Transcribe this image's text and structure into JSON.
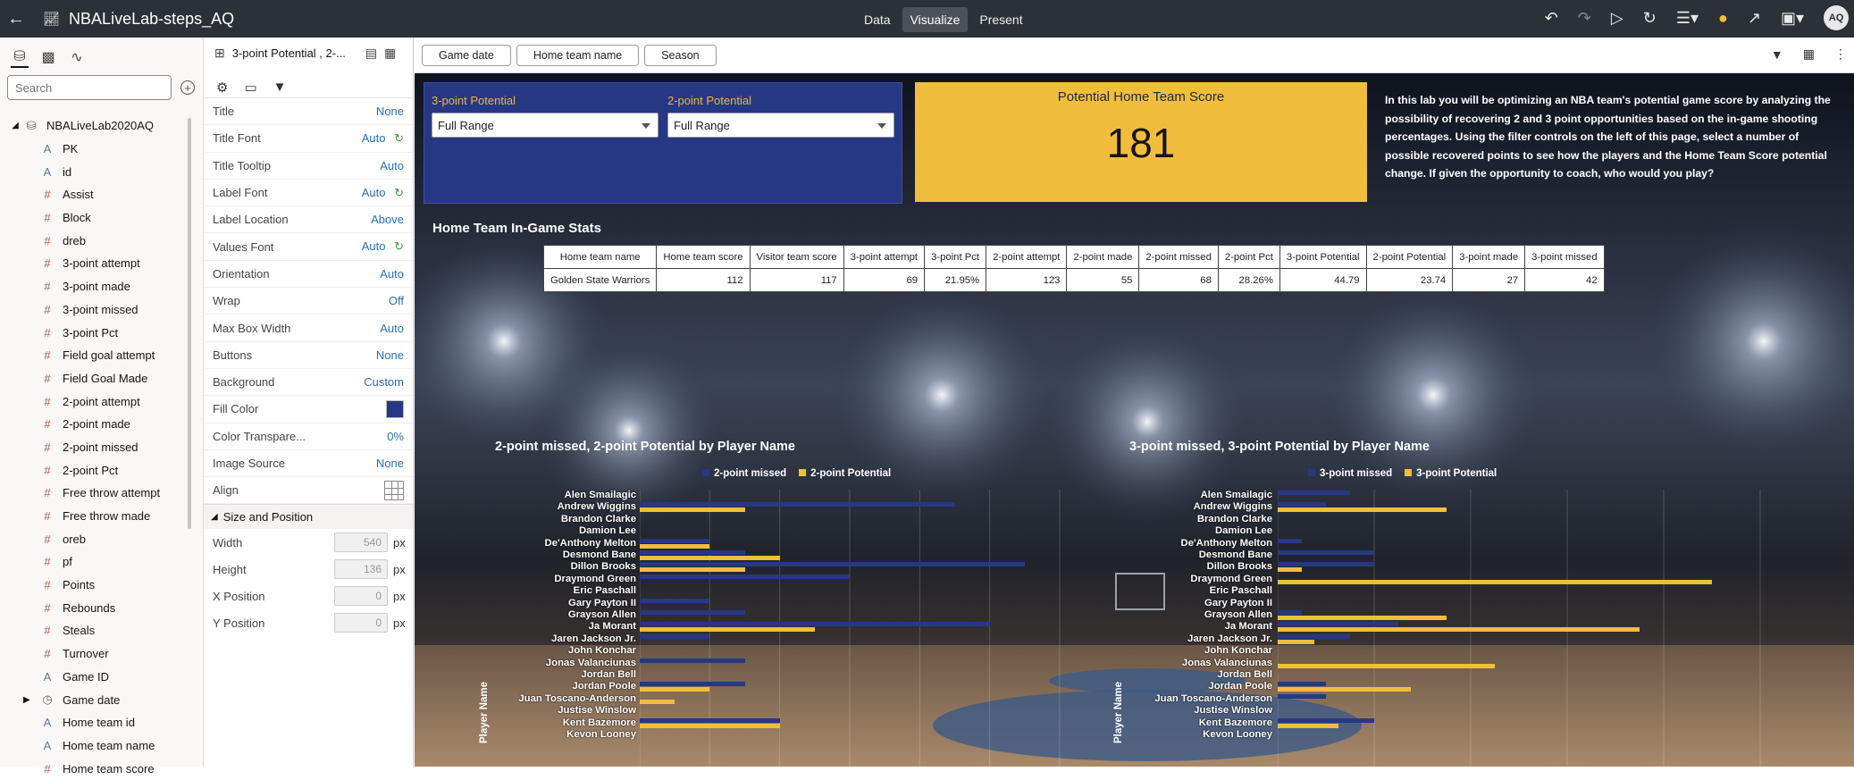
{
  "app": {
    "title": "NBALiveLab-steps_AQ",
    "modes": [
      "Data",
      "Visualize",
      "Present"
    ],
    "active_mode": "Visualize",
    "avatar": "AQ"
  },
  "left_panel": {
    "search_placeholder": "Search",
    "dataset": "NBALiveLab2020AQ",
    "items": [
      {
        "label": "PK",
        "kind": "text"
      },
      {
        "label": "id",
        "kind": "text"
      },
      {
        "label": "Assist",
        "kind": "number"
      },
      {
        "label": "Block",
        "kind": "number"
      },
      {
        "label": "dreb",
        "kind": "number"
      },
      {
        "label": "3-point attempt",
        "kind": "number"
      },
      {
        "label": "3-point made",
        "kind": "number"
      },
      {
        "label": "3-point missed",
        "kind": "number"
      },
      {
        "label": "3-point Pct",
        "kind": "number"
      },
      {
        "label": "Field goal attempt",
        "kind": "number"
      },
      {
        "label": "Field Goal Made",
        "kind": "number"
      },
      {
        "label": "2-point attempt",
        "kind": "number"
      },
      {
        "label": "2-point made",
        "kind": "number"
      },
      {
        "label": "2-point missed",
        "kind": "number"
      },
      {
        "label": "2-point Pct",
        "kind": "number"
      },
      {
        "label": "Free throw attempt",
        "kind": "number"
      },
      {
        "label": "Free throw made",
        "kind": "number"
      },
      {
        "label": "oreb",
        "kind": "number"
      },
      {
        "label": "pf",
        "kind": "number"
      },
      {
        "label": "Points",
        "kind": "number"
      },
      {
        "label": "Rebounds",
        "kind": "number"
      },
      {
        "label": "Steals",
        "kind": "number"
      },
      {
        "label": "Turnover",
        "kind": "number"
      },
      {
        "label": "Game ID",
        "kind": "text"
      },
      {
        "label": "Game date",
        "kind": "clock"
      },
      {
        "label": "Home team id",
        "kind": "text"
      },
      {
        "label": "Home team name",
        "kind": "text"
      },
      {
        "label": "Home team score",
        "kind": "number"
      }
    ]
  },
  "props": {
    "header": "3-point Potential , 2-...",
    "rows": [
      {
        "label": "Title",
        "value": "None"
      },
      {
        "label": "Title Font",
        "value": "Auto"
      },
      {
        "label": "Title Tooltip",
        "value": "Auto"
      },
      {
        "label": "Label Font",
        "value": "Auto"
      },
      {
        "label": "Label Location",
        "value": "Above"
      },
      {
        "label": "Values Font",
        "value": "Auto"
      },
      {
        "label": "Orientation",
        "value": "Auto"
      },
      {
        "label": "Wrap",
        "value": "Off"
      },
      {
        "label": "Max Box Width",
        "value": "Auto"
      },
      {
        "label": "Buttons",
        "value": "None"
      },
      {
        "label": "Background",
        "value": "Custom"
      },
      {
        "label": "Fill Color",
        "value": ""
      },
      {
        "label": "Color Transpare...",
        "value": "0%"
      },
      {
        "label": "Image Source",
        "value": "None"
      },
      {
        "label": "Align",
        "value": ""
      }
    ],
    "fill_color": "#263884",
    "size_header": "Size and Position",
    "size": [
      {
        "label": "Width",
        "value": "540",
        "unit": "px"
      },
      {
        "label": "Height",
        "value": "136",
        "unit": "px"
      },
      {
        "label": "X Position",
        "value": "0",
        "unit": "px"
      },
      {
        "label": "Y Position",
        "value": "0",
        "unit": "px"
      }
    ]
  },
  "filters": [
    "Game date",
    "Home team name",
    "Season"
  ],
  "canvas": {
    "controls": [
      {
        "label": "3-point Potential",
        "value": "Full Range"
      },
      {
        "label": "2-point Potential",
        "value": "Full Range"
      }
    ],
    "score": {
      "title": "Potential Home Team Score",
      "value": "181"
    },
    "intro": "In this lab you will be optimizing an NBA team's potential game score by analyzing the possibility of recovering 2 and 3 point opportunities based on the in-game shooting percentages. Using the filter controls on the left of this page, select a number of possible recovered points to see how the players and the Home Team Score potential change. If given the opportunity to coach, who would you play?",
    "table_title": "Home Team In-Game Stats",
    "table": {
      "headers": [
        "Home team name",
        "Home team score",
        "Visitor team score",
        "3-point attempt",
        "3-point Pct",
        "2-point attempt",
        "2-point made",
        "2-point missed",
        "2-point Pct",
        "3-point Potential",
        "2-point Potential",
        "3-point made",
        "3-point missed"
      ],
      "rows": [
        [
          "Golden State Warriors",
          "112",
          "117",
          "69",
          "21.95%",
          "123",
          "55",
          "68",
          "28.26%",
          "44.79",
          "23.74",
          "27",
          "42"
        ]
      ]
    },
    "colors": {
      "navy": "#263884",
      "gold": "#f1bd3c"
    }
  },
  "chart_data": [
    {
      "type": "bar",
      "orientation": "horizontal",
      "title": "2-point missed, 2-point Potential by Player Name",
      "ylabel": "Player Name",
      "categories": [
        "Alen Smailagic",
        "Andrew Wiggins",
        "Brandon Clarke",
        "Damion Lee",
        "De'Anthony Melton",
        "Desmond Bane",
        "Dillon Brooks",
        "Draymond Green",
        "Eric Paschall",
        "Gary Payton II",
        "Grayson Allen",
        "Ja Morant",
        "Jaren Jackson Jr.",
        "John Konchar",
        "Jonas Valanciunas",
        "Jordan Bell",
        "Jordan Poole",
        "Juan Toscano-Anderson",
        "Justise Winslow",
        "Kent Bazemore",
        "Kevon Looney"
      ],
      "series": [
        {
          "name": "2-point missed",
          "color": "#263884",
          "values": [
            0,
            9,
            0,
            0,
            2,
            3,
            11,
            6,
            0,
            2,
            3,
            10,
            2,
            0,
            3,
            0,
            3,
            0,
            0,
            4,
            0
          ]
        },
        {
          "name": "2-point Potential",
          "color": "#f1bd3c",
          "values": [
            0,
            3,
            0,
            0,
            2,
            4,
            3,
            0,
            0,
            0,
            0,
            5,
            0,
            0,
            0,
            0,
            2,
            1,
            0,
            4,
            0
          ]
        }
      ],
      "xlim": [
        0,
        12
      ],
      "legend": "top"
    },
    {
      "type": "bar",
      "orientation": "horizontal",
      "title": "3-point missed, 3-point Potential by Player Name",
      "ylabel": "Player Name",
      "categories": [
        "Alen Smailagic",
        "Andrew Wiggins",
        "Brandon Clarke",
        "Damion Lee",
        "De'Anthony Melton",
        "Desmond Bane",
        "Dillon Brooks",
        "Draymond Green",
        "Eric Paschall",
        "Gary Payton II",
        "Grayson Allen",
        "Ja Morant",
        "Jaren Jackson Jr.",
        "John Konchar",
        "Jonas Valanciunas",
        "Jordan Bell",
        "Jordan Poole",
        "Juan Toscano-Anderson",
        "Justise Winslow",
        "Kent Bazemore",
        "Kevon Looney"
      ],
      "series": [
        {
          "name": "3-point missed",
          "color": "#263884",
          "values": [
            3,
            2,
            0,
            0,
            1,
            4,
            4,
            0,
            0,
            0,
            1,
            5,
            3,
            0,
            0,
            0,
            2,
            2,
            0,
            4,
            0
          ]
        },
        {
          "name": "3-point Potential",
          "color": "#f1bd3c",
          "values": [
            0,
            7,
            0,
            0,
            0,
            0,
            1,
            18,
            0,
            0,
            7,
            15,
            1.5,
            0,
            9,
            0,
            5.5,
            0,
            0,
            2.5,
            0
          ]
        }
      ],
      "xlim": [
        0,
        20
      ],
      "legend": "top"
    }
  ]
}
